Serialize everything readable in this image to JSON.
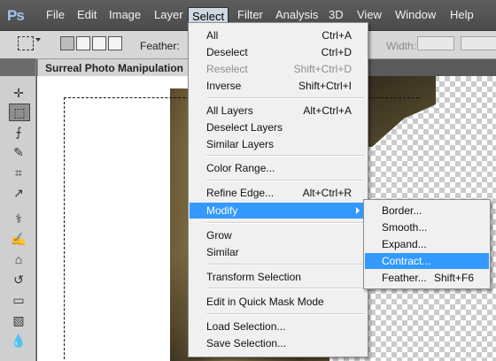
{
  "menubar": {
    "logo": "Ps",
    "items": [
      "File",
      "Edit",
      "Image",
      "Layer",
      "Select",
      "Filter",
      "Analysis",
      "3D",
      "View",
      "Window",
      "Help"
    ],
    "active": "Select"
  },
  "options": {
    "feather_label": "Feather:",
    "width_label": "Width:"
  },
  "document": {
    "tab_title": "Surreal Photo Manipulation @"
  },
  "select_menu": {
    "items": [
      {
        "label": "All",
        "shortcut": "Ctrl+A"
      },
      {
        "label": "Deselect",
        "shortcut": "Ctrl+D"
      },
      {
        "label": "Reselect",
        "shortcut": "Shift+Ctrl+D",
        "disabled": true
      },
      {
        "label": "Inverse",
        "shortcut": "Shift+Ctrl+I"
      },
      {
        "label": "All Layers",
        "shortcut": "Alt+Ctrl+A"
      },
      {
        "label": "Deselect Layers",
        "shortcut": ""
      },
      {
        "label": "Similar Layers",
        "shortcut": ""
      },
      {
        "label": "Color Range...",
        "shortcut": ""
      },
      {
        "label": "Refine Edge...",
        "shortcut": "Alt+Ctrl+R"
      },
      {
        "label": "Modify",
        "shortcut": "",
        "highlighted": true
      },
      {
        "label": "Grow",
        "shortcut": ""
      },
      {
        "label": "Similar",
        "shortcut": ""
      },
      {
        "label": "Transform Selection",
        "shortcut": ""
      },
      {
        "label": "Edit in Quick Mask Mode",
        "shortcut": ""
      },
      {
        "label": "Load Selection...",
        "shortcut": ""
      },
      {
        "label": "Save Selection...",
        "shortcut": ""
      }
    ]
  },
  "modify_menu": {
    "items": [
      {
        "label": "Border...",
        "shortcut": ""
      },
      {
        "label": "Smooth...",
        "shortcut": ""
      },
      {
        "label": "Expand...",
        "shortcut": ""
      },
      {
        "label": "Contract...",
        "shortcut": "",
        "highlighted": true
      },
      {
        "label": "Feather...",
        "shortcut": "Shift+F6"
      }
    ]
  },
  "colors": {
    "highlight": "#3399ff",
    "menubar": "#555555",
    "menu_bg": "#f0f0f0"
  },
  "icons": [
    "move-icon",
    "rectangular-marquee-icon",
    "lasso-icon",
    "quick-selection-icon",
    "crop-icon",
    "eyedropper-icon",
    "spot-healing-icon",
    "brush-icon",
    "clone-stamp-icon",
    "history-brush-icon",
    "eraser-icon",
    "gradient-icon",
    "blur-icon",
    "dodge-icon"
  ]
}
